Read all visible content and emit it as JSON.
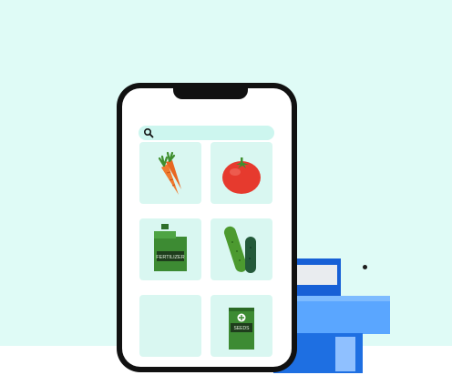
{
  "search": {
    "placeholder": ""
  },
  "products": [
    {
      "name": "carrots",
      "icon": "carrot-icon"
    },
    {
      "name": "tomato",
      "icon": "tomato-icon"
    },
    {
      "name": "fertilizer",
      "icon": "fertilizer-can-icon",
      "label": "FERTILIZER"
    },
    {
      "name": "cucumbers",
      "icon": "cucumber-icon"
    },
    {
      "name": "empty",
      "icon": ""
    },
    {
      "name": "seeds",
      "icon": "seed-packet-icon",
      "label": "SEEDS"
    }
  ],
  "colors": {
    "background": "#dffbf6",
    "tile": "#d9f7f1",
    "phone": "#111111",
    "accent_blue": "#1e6fe2"
  }
}
